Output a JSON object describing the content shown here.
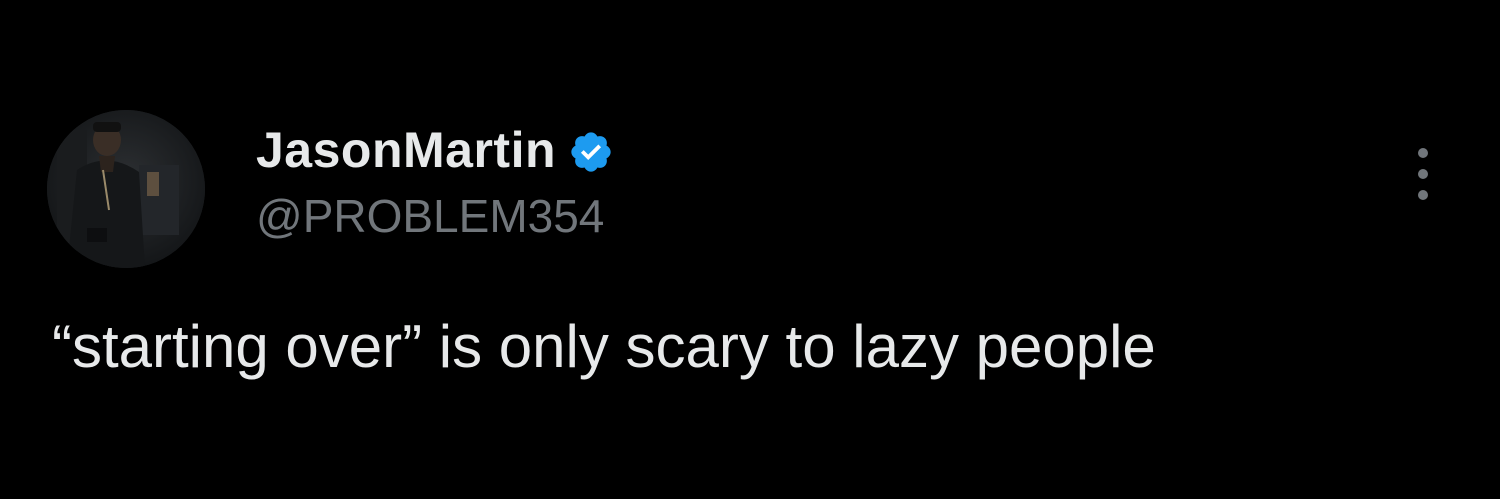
{
  "tweet": {
    "author": {
      "display_name": "JasonMartin",
      "handle": "@PROBLEM354",
      "verified": true,
      "avatar_icon": "profile-photo"
    },
    "text": "“starting over” is only scary to lazy people",
    "menu_icon": "more-options-vertical-icon"
  },
  "colors": {
    "background": "#000000",
    "primary_text": "#e7e9ea",
    "secondary_text": "#71767b",
    "verified_badge": "#1d9bf0"
  }
}
